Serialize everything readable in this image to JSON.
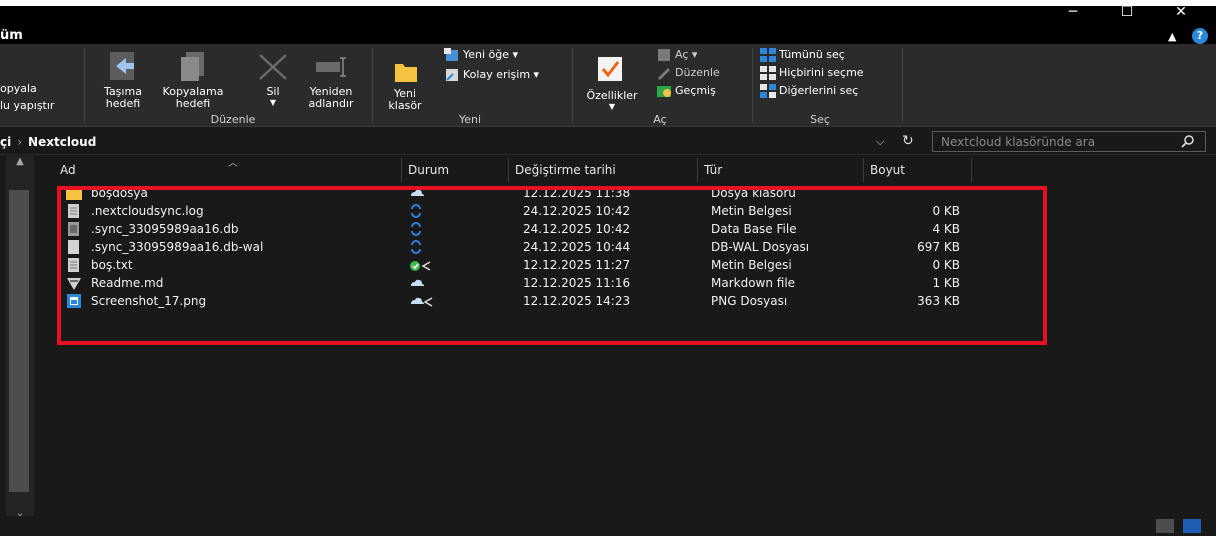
{
  "window": {
    "minimize_glyph": "─",
    "maximize_glyph": "☐",
    "close_glyph": "✕"
  },
  "ribbon": {
    "tab_label": "üm",
    "help_label": "?",
    "clipboard": {
      "copy_label": "opyala",
      "paste_shortcut_label": "lu yapıştır"
    },
    "organize": {
      "group_label": "Düzenle",
      "move_to_line1": "Taşıma",
      "move_to_line2": "hedefi",
      "copy_to_line1": "Kopyalama",
      "copy_to_line2": "hedefi",
      "delete_label": "Sil",
      "rename_line1": "Yeniden",
      "rename_line2": "adlandır"
    },
    "new": {
      "group_label": "Yeni",
      "new_folder_line1": "Yeni",
      "new_folder_line2": "klasör",
      "new_item_label": "Yeni öğe",
      "easy_access_label": "Kolay erişim"
    },
    "open": {
      "group_label": "Aç",
      "properties_label": "Özellikler",
      "open_label": "Aç",
      "edit_label": "Düzenle",
      "history_label": "Geçmiş"
    },
    "select": {
      "group_label": "Seç",
      "select_all_label": "Tümünü seç",
      "select_none_label": "Hiçbirini seçme",
      "invert_label": "Diğerlerini seç"
    }
  },
  "address": {
    "crumb_prev": "çi",
    "crumb_current": "Nextcloud",
    "search_placeholder": "Nextcloud klasöründe ara"
  },
  "columns": {
    "name": "Ad",
    "status": "Durum",
    "modified": "Değiştirme tarihi",
    "type": "Tür",
    "size": "Boyut"
  },
  "files": [
    {
      "name": "boşdosya",
      "status": "cloud",
      "modified": "12.12.2025 11:38",
      "type": "Dosya klasörü",
      "size": "",
      "icon": "folder-icon"
    },
    {
      "name": ".nextcloudsync.log",
      "status": "sync",
      "modified": "24.12.2025 10:42",
      "type": "Metin Belgesi",
      "size": "0 KB",
      "icon": "text-file-icon"
    },
    {
      "name": ".sync_33095989aa16.db",
      "status": "sync",
      "modified": "24.12.2025 10:42",
      "type": "Data Base File",
      "size": "4 KB",
      "icon": "database-file-icon"
    },
    {
      "name": ".sync_33095989aa16.db-wal",
      "status": "sync",
      "modified": "24.12.2025 10:44",
      "type": "DB-WAL Dosyası",
      "size": "697 KB",
      "icon": "generic-file-icon"
    },
    {
      "name": "boş.txt",
      "status": "synced-shared",
      "modified": "12.12.2025 11:27",
      "type": "Metin Belgesi",
      "size": "0 KB",
      "icon": "text-file-icon"
    },
    {
      "name": "Readme.md",
      "status": "cloud",
      "modified": "12.12.2025 11:16",
      "type": "Markdown file",
      "size": "1 KB",
      "icon": "markdown-file-icon"
    },
    {
      "name": "Screenshot_17.png",
      "status": "cloud-shared",
      "modified": "12.12.2025 14:23",
      "type": "PNG Dosyası",
      "size": "363 KB",
      "icon": "image-file-icon"
    }
  ],
  "colors": {
    "highlight": "#e81123",
    "cloud": "#c8dcf5",
    "sync": "#2f7fd8",
    "ok": "#3fb950",
    "accent": "#2b88d8"
  }
}
